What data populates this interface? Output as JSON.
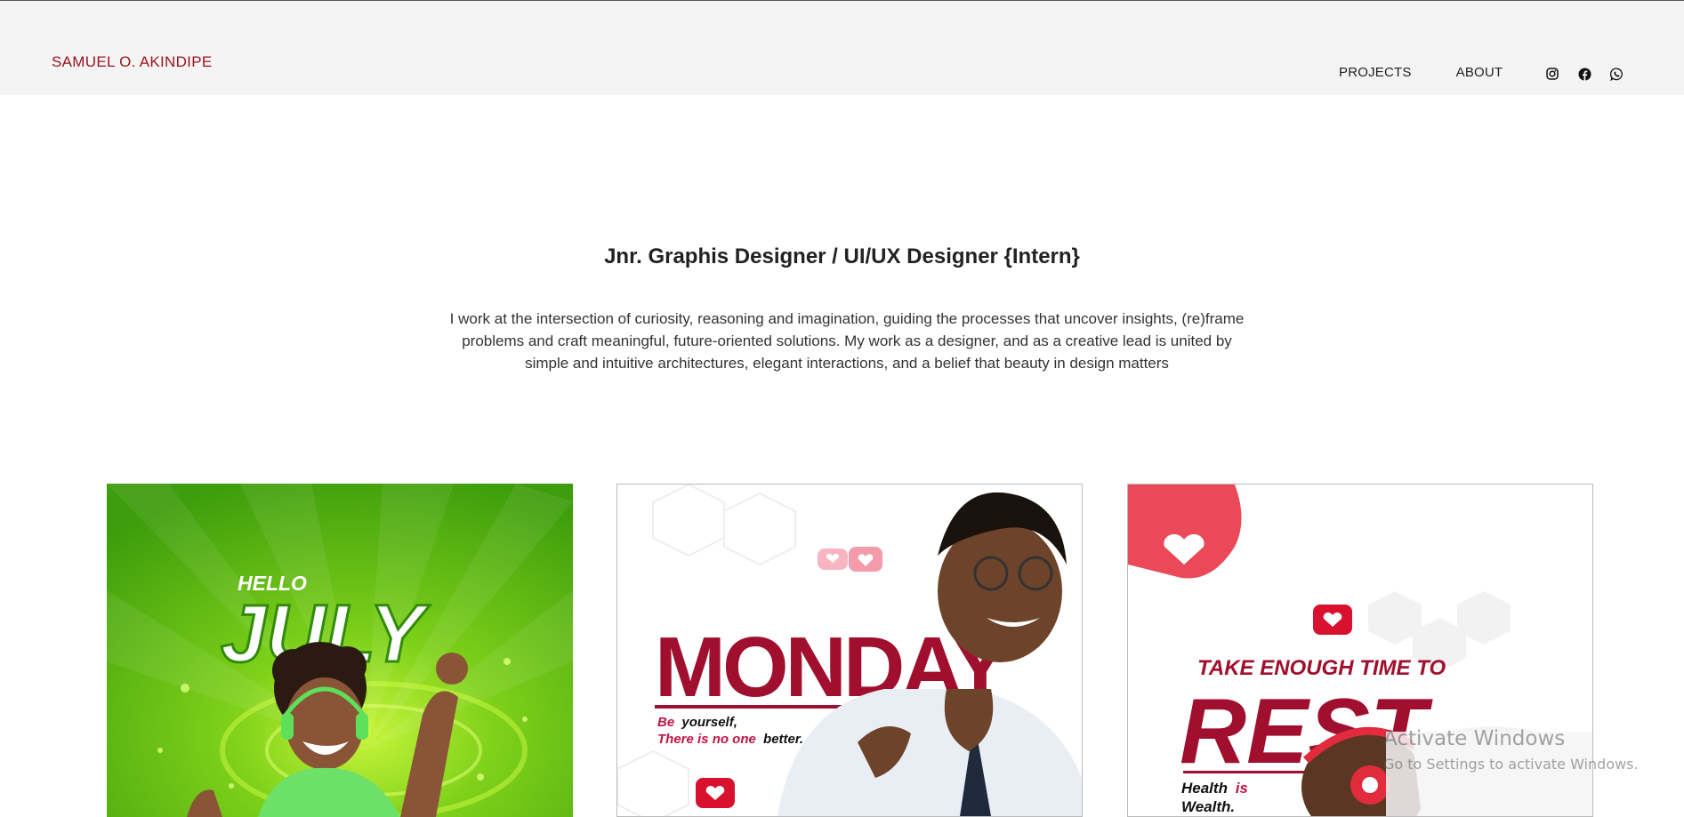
{
  "header": {
    "brand": "SAMUEL O. AKINDIPE",
    "nav": [
      "PROJECTS",
      "ABOUT"
    ],
    "social": [
      "instagram-icon",
      "facebook-icon",
      "whatsapp-icon"
    ]
  },
  "hero": {
    "headline": "Jnr. Graphis Designer / UI/UX Designer {Intern}",
    "intro": "I work at the intersection of curiosity, reasoning and imagination, guiding the processes that uncover insights, (re)frame problems and craft meaningful, future-oriented solutions. My work as a designer, and as a creative lead is united by simple and intuitive architectures, elegant interactions, and a belief that beauty in design matters"
  },
  "cards": [
    {
      "line1": "HELLO",
      "line2": "JULY"
    },
    {
      "title": "MONDAY",
      "tag_be": "Be",
      "tag_yourself": "yourself,",
      "tag_line2a": "There is no one",
      "tag_line2b": "better."
    },
    {
      "line1": "TAKE ENOUGH TIME TO",
      "line2": "REST",
      "tag_a": "Health",
      "tag_b": "is",
      "tag_c": "Wealth."
    }
  ],
  "overlay": {
    "title": "Activate Windows",
    "subtitle": "Go to Settings to activate Windows."
  },
  "colors": {
    "brand": "#9b1420",
    "header_bg": "#f4f4f4",
    "green": "#4bb012",
    "crimson": "#a0102e"
  }
}
